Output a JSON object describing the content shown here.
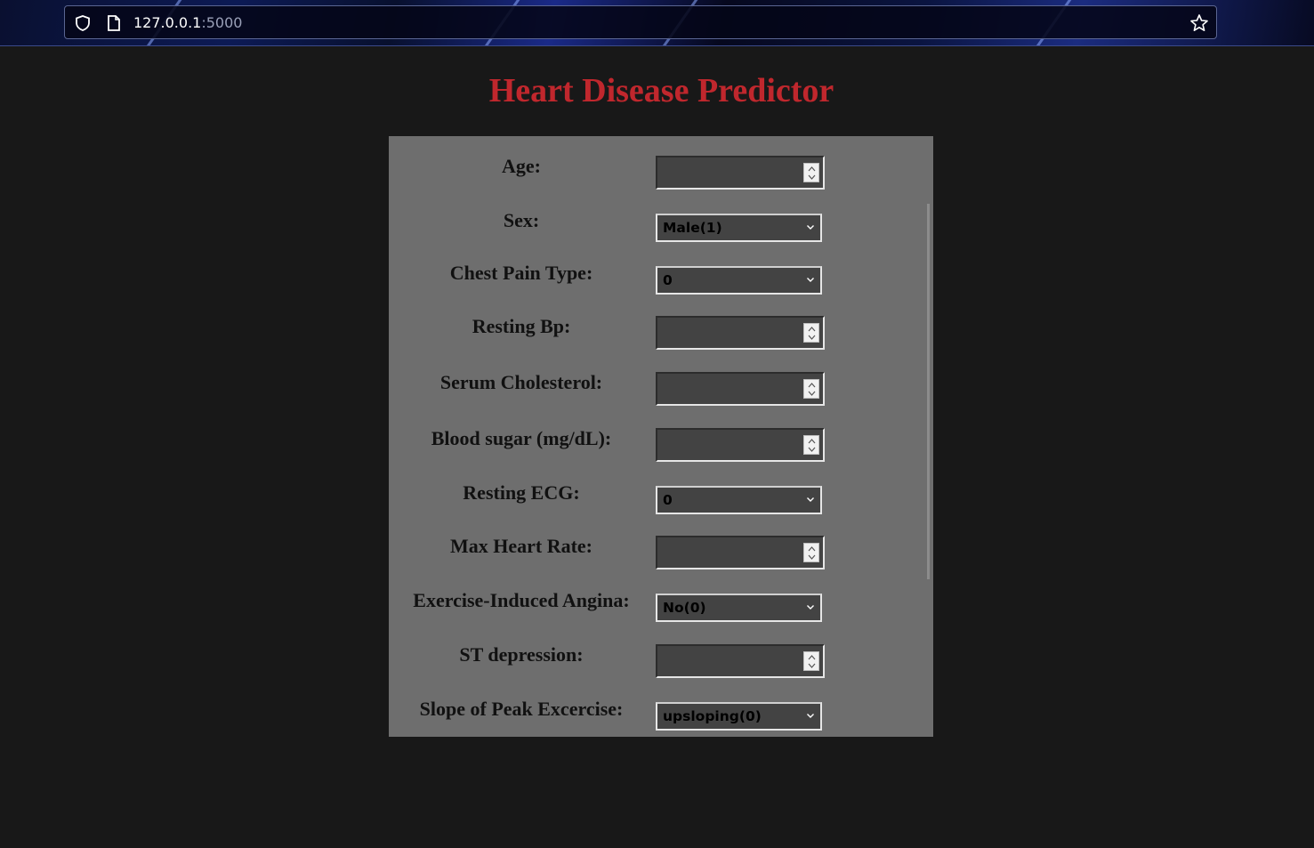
{
  "browser": {
    "url_host": "127.0.0.1",
    "url_port": ":5000"
  },
  "page": {
    "title": "Heart Disease Predictor"
  },
  "form": {
    "age": {
      "label": "Age:",
      "value": ""
    },
    "sex": {
      "label": "Sex:",
      "selected": "Male(1)"
    },
    "chest_pain": {
      "label": "Chest Pain Type:",
      "selected": "0"
    },
    "resting_bp": {
      "label": "Resting Bp:",
      "value": ""
    },
    "cholesterol": {
      "label": "Serum Cholesterol:",
      "value": ""
    },
    "blood_sugar": {
      "label": "Blood sugar (mg/dL):",
      "value": ""
    },
    "resting_ecg": {
      "label": "Resting ECG:",
      "selected": "0"
    },
    "max_hr": {
      "label": "Max Heart Rate:",
      "value": ""
    },
    "angina": {
      "label": "Exercise-Induced Angina:",
      "selected": "No(0)"
    },
    "st_depression": {
      "label": "ST depression:",
      "value": ""
    },
    "slope": {
      "label": "Slope of Peak Excercise:",
      "selected": "upsloping(0)"
    }
  },
  "colors": {
    "title": "#c0272d",
    "panel": "#6e6e6e",
    "background": "#181818",
    "input": "#434343"
  }
}
